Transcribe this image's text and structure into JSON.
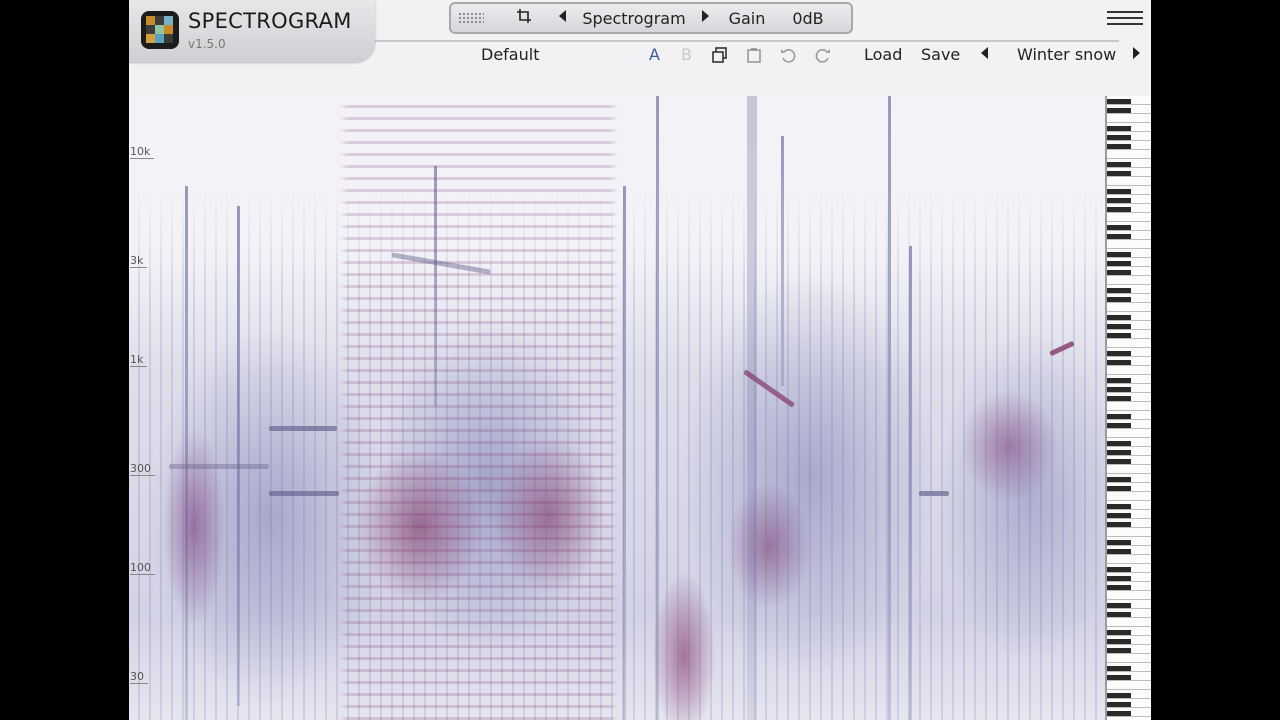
{
  "app": {
    "title": "SPECTROGRAM",
    "version": "v1.5.0"
  },
  "topbar": {
    "view_label": "Spectrogram",
    "gain_label": "Gain",
    "gain_value": "0dB",
    "icons": [
      "grip-icon",
      "crop-icon",
      "chevron-left-icon",
      "chevron-right-icon",
      "hamburger-menu-icon"
    ]
  },
  "preset_bar": {
    "current": "Default",
    "ab_a": "A",
    "ab_b": "B",
    "load_label": "Load",
    "save_label": "Save",
    "preset_name": "Winter snow",
    "icons": [
      "copy-icon",
      "paste-icon",
      "undo-icon",
      "redo-icon"
    ]
  },
  "frequency_axis": {
    "labels": [
      "10k",
      "3k",
      "1k",
      "300",
      "100",
      "30"
    ]
  },
  "colors": {
    "background": "#f2f2f5",
    "spectrum_low": "#6e6eaa",
    "spectrum_high": "#7a1e50",
    "ab_active": "#3a5a9a"
  }
}
